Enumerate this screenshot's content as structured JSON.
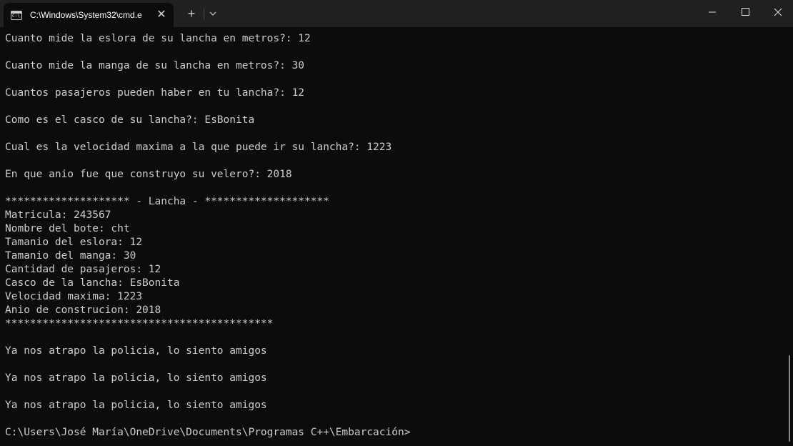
{
  "window": {
    "tab_title": "C:\\Windows\\System32\\cmd.e",
    "tab_close": "✕",
    "new_tab": "+"
  },
  "terminal": {
    "lines": [
      "Cuanto mide la eslora de su lancha en metros?: 12",
      "",
      "Cuanto mide la manga de su lancha en metros?: 30",
      "",
      "Cuantos pasajeros pueden haber en tu lancha?: 12",
      "",
      "Como es el casco de su lancha?: EsBonita",
      "",
      "Cual es la velocidad maxima a la que puede ir su lancha?: 1223",
      "",
      "En que anio fue que construyo su velero?: 2018",
      "",
      "******************** - Lancha - ********************",
      "Matricula: 243567",
      "Nombre del bote: cht",
      "Tamanio del eslora: 12",
      "Tamanio del manga: 30",
      "Cantidad de pasajeros: 12",
      "Casco de la lancha: EsBonita",
      "Velocidad maxima: 1223",
      "Anio de construcion: 2018",
      "*******************************************",
      "",
      "Ya nos atrapo la policia, lo siento amigos",
      "",
      "Ya nos atrapo la policia, lo siento amigos",
      "",
      "Ya nos atrapo la policia, lo siento amigos",
      "",
      "C:\\Users\\José María\\OneDrive\\Documents\\Programas C++\\Embarcación>"
    ]
  }
}
